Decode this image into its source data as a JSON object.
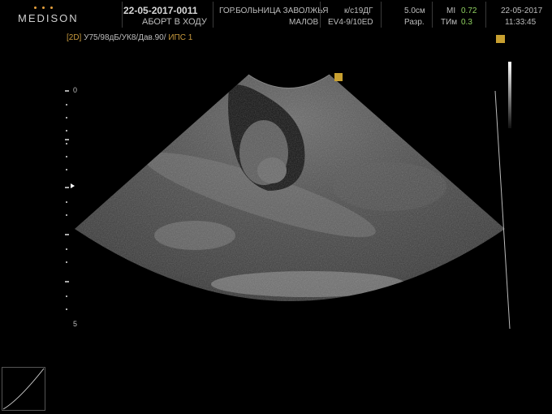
{
  "header": {
    "brand": "MEDISON",
    "patient_id": "22-05-2017-0011",
    "patient_name": "АБОРТ В ХОДУ",
    "institution": "ГОР.БОЛЬНИЦА ЗАВОЛЖЬЯ",
    "operator": "МАЛОВ",
    "preset": "к/с19ДГ",
    "probe": "EV4-9/10ED",
    "depth": "5.0см",
    "res": "Разр.",
    "mi_label": "MI",
    "mi_value": "0.72",
    "tim_label": "ТИм",
    "tim_value": "0.3",
    "date": "22-05-2017",
    "time": "11:33:45"
  },
  "subheader": {
    "mode": "[2D]",
    "params": "У75/98дБ/УК8/Дав.90/",
    "ips": "ИПС 1"
  },
  "scale": {
    "top_label": "0",
    "bottom_label": "5"
  },
  "colors": {
    "accent": "#c8a030",
    "mode_text": "#c89a3e",
    "mi_value": "#8fd060"
  }
}
